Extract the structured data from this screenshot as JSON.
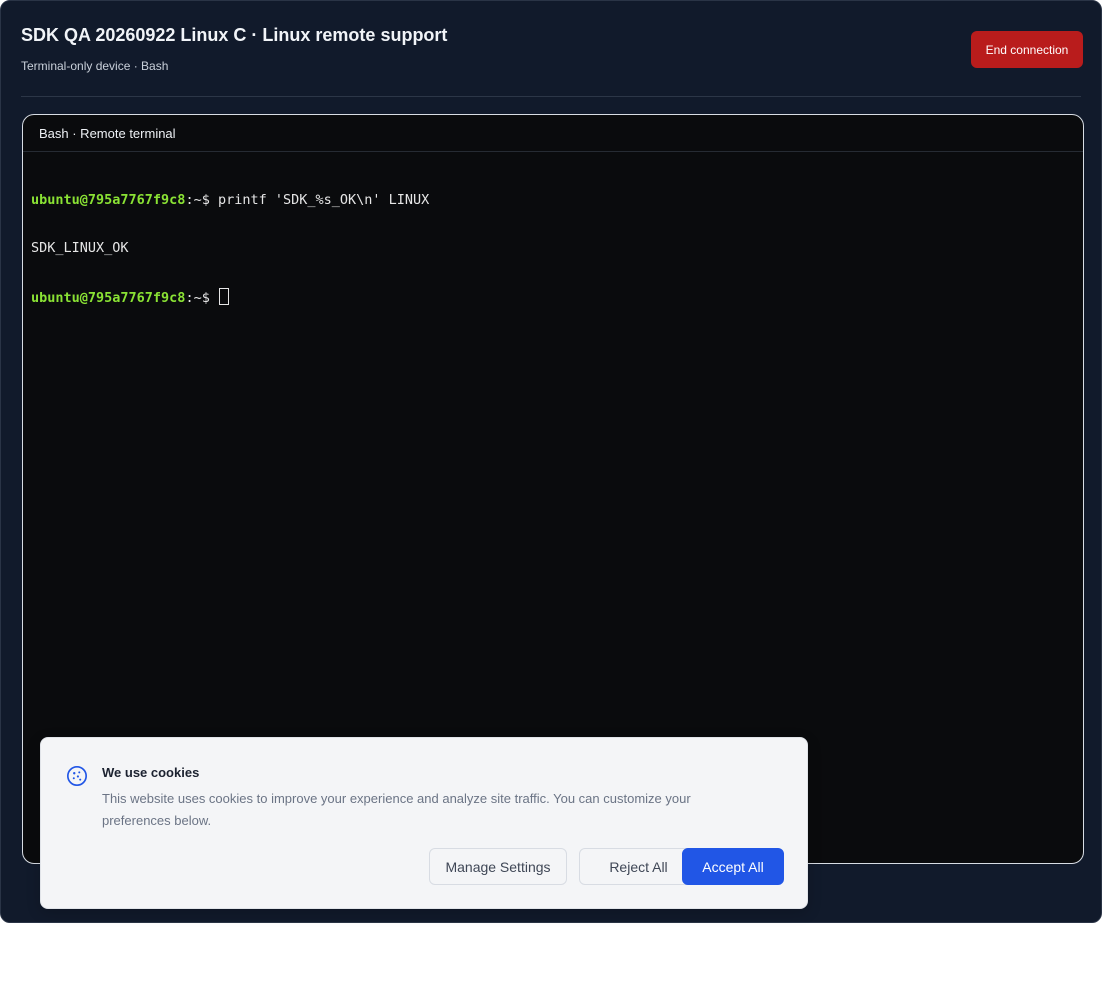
{
  "header": {
    "title": "SDK QA 20260922 Linux C · Linux remote support",
    "subtitle": "Terminal-only device · Bash",
    "end_button_label": "End connection"
  },
  "terminal": {
    "header_label": "Bash · Remote terminal",
    "lines": [
      {
        "user": "ubuntu@795a7767f9c8",
        "path": ":~$ ",
        "command": "printf 'SDK_%s_OK\\n' LINUX"
      },
      {
        "output": "SDK_LINUX_OK"
      },
      {
        "user": "ubuntu@795a7767f9c8",
        "path": ":~$ ",
        "command": ""
      }
    ]
  },
  "cookie_banner": {
    "icon": "cookie-icon",
    "title": "We use cookies",
    "text": "This website uses cookies to improve your experience and analyze site traffic. You can customize your preferences below.",
    "manage_label": "Manage Settings",
    "reject_label": "Reject All",
    "accept_label": "Accept All"
  },
  "colors": {
    "background": "#111a2b",
    "terminal_bg": "#0a0b0d",
    "prompt_user": "#8ae234",
    "danger": "#b91c1c",
    "accent": "#2156e6"
  }
}
